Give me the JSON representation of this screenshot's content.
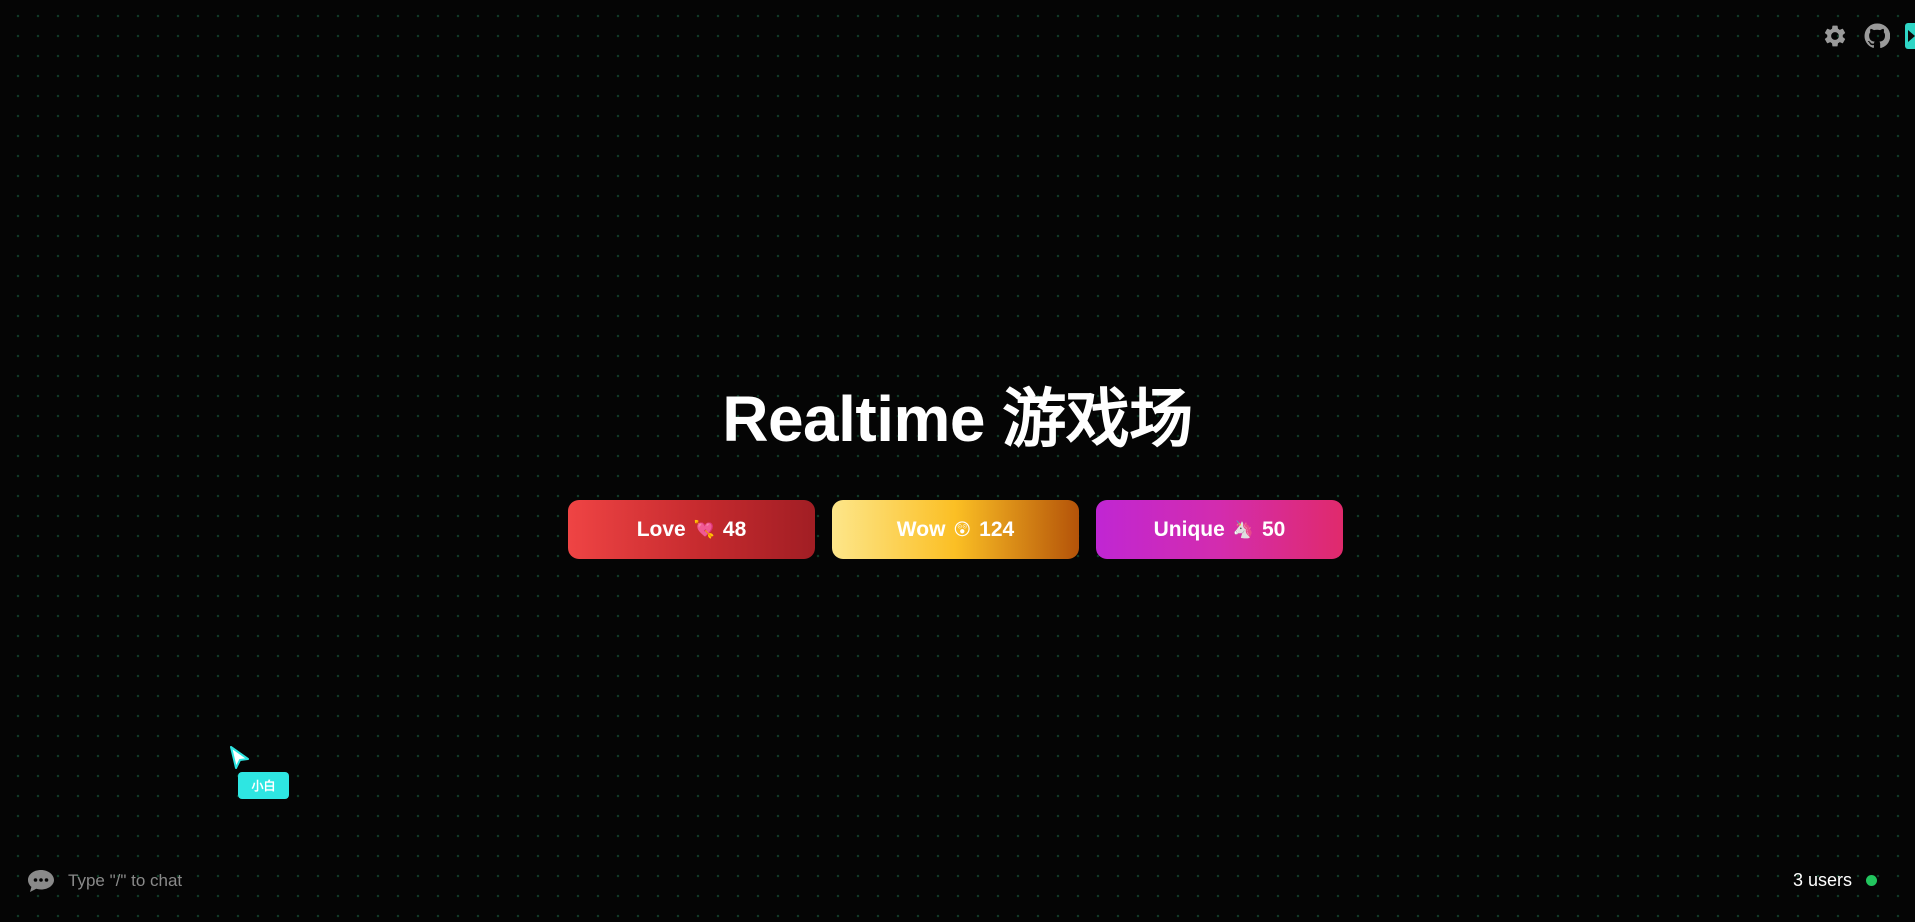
{
  "header": {
    "settings_icon": "gear-icon",
    "github_icon": "github-icon",
    "panel_toggle_icon": "chevron-right-icon"
  },
  "title": "Realtime 游戏场",
  "reactions": [
    {
      "label": "Love",
      "emoji": "💘",
      "count": "48",
      "color_start": "#ef4444",
      "color_end": "#a11e24"
    },
    {
      "label": "Wow",
      "emoji": "😲",
      "count": "124",
      "color_start": "#fde68a",
      "color_end": "#b45309"
    },
    {
      "label": "Unique",
      "emoji": "🦄",
      "count": "50",
      "color_start": "#c026d3",
      "color_end": "#e02a6c"
    }
  ],
  "cursor": {
    "name": "小白",
    "color": "#2ee6e2"
  },
  "chat": {
    "placeholder": "Type \"/\" to chat",
    "icon": "chat-bubble-icon"
  },
  "presence": {
    "users_label": "3 users",
    "status_color": "#22c55e"
  }
}
